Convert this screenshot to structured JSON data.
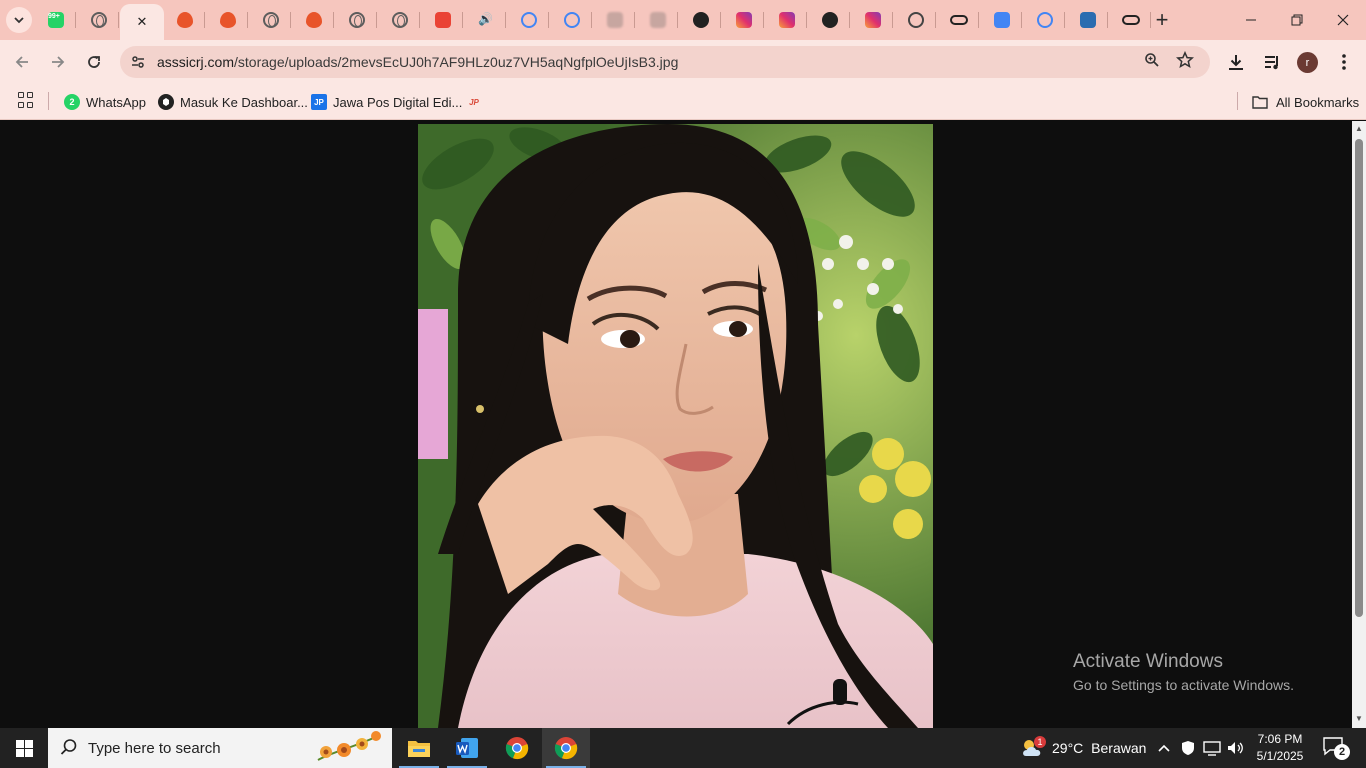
{
  "browser": {
    "url_host": "asssicrj.com",
    "url_path": "/storage/uploads/2mevsEcUJ0h7AF9HLz0uz7VH5aqNgfplOeUjIsB3.jpg",
    "profile_initial": "r",
    "new_tab_glyph": "+",
    "tabs": [
      {
        "icon": "whatsapp-icon",
        "badge": "99+",
        "color": "#25d366"
      },
      {
        "icon": "globe-icon"
      },
      {
        "icon": "close-icon",
        "active": true,
        "glyph": "✕"
      },
      {
        "icon": "flame-icon",
        "color": "#e8542a"
      },
      {
        "icon": "flame-icon",
        "color": "#e8542a"
      },
      {
        "icon": "globe-icon"
      },
      {
        "icon": "flame-icon",
        "color": "#e8542a"
      },
      {
        "icon": "globe-icon"
      },
      {
        "icon": "globe-icon"
      },
      {
        "icon": "gmail-icon",
        "color": "#ea4335"
      },
      {
        "icon": "speaker-icon"
      },
      {
        "icon": "google-icon",
        "color": "#4285f4"
      },
      {
        "icon": "google-icon",
        "color": "#4285f4"
      },
      {
        "icon": "blurred-icon"
      },
      {
        "icon": "blurred-icon"
      },
      {
        "icon": "dark-circle-icon"
      },
      {
        "icon": "instagram-icon",
        "color": "#e1306c"
      },
      {
        "icon": "instagram-icon",
        "color": "#e1306c"
      },
      {
        "icon": "threads-icon"
      },
      {
        "icon": "instagram-icon",
        "color": "#e1306c"
      },
      {
        "icon": "chrome-outline-icon"
      },
      {
        "icon": "glasses-icon"
      },
      {
        "icon": "docs-icon",
        "color": "#4285f4"
      },
      {
        "icon": "google-icon",
        "color": "#4285f4"
      },
      {
        "icon": "plane-icon",
        "color": "#2b6cb0"
      },
      {
        "icon": "glasses-icon"
      }
    ]
  },
  "bookmarks": {
    "items": [
      {
        "label": "WhatsApp",
        "icon": "whatsapp-icon",
        "color": "#25d366",
        "badge": "2"
      },
      {
        "label": "Masuk Ke Dashboar...",
        "icon": "dark-circle-icon",
        "color": "#222222"
      },
      {
        "label": "Jawa Pos Digital Edi...",
        "icon": "jp-icon",
        "color": "#1a73e8",
        "badge": "JP"
      },
      {
        "label": "",
        "icon": "jr-icon",
        "color": "#d94a3a",
        "badge": "JP"
      }
    ],
    "all_bookmarks": "All Bookmarks"
  },
  "watermark": {
    "line1": "Activate Windows",
    "line2": "Go to Settings to activate Windows."
  },
  "taskbar": {
    "search_placeholder": "Type here to search",
    "weather_temp": "29°C",
    "weather_text": "Berawan",
    "weather_badge": "1",
    "time": "7:06 PM",
    "date": "5/1/2025",
    "notifications": "2"
  }
}
